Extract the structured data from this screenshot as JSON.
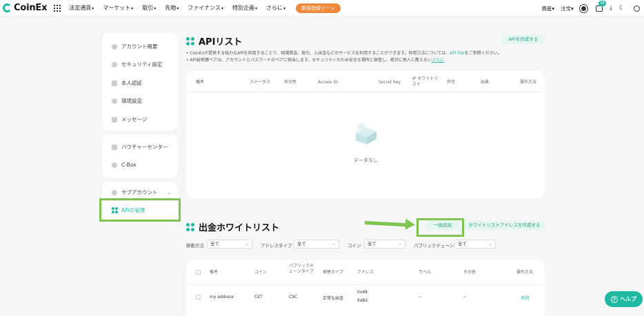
{
  "header": {
    "brand": "CoinEx",
    "nav": [
      "法定通貨",
      "マーケット",
      "取引",
      "先物",
      "ファイナンス",
      "特別企画",
      "さらに"
    ],
    "promo": "新規登録ゾーン",
    "right": [
      "資産",
      "注文"
    ],
    "notification_count": "26"
  },
  "sidebar": {
    "group1": [
      "アカウント概要",
      "セキュリティ設定",
      "本人認証",
      "環境設定",
      "メッセージ"
    ],
    "group2": [
      "バウチャーセンター",
      "C-Box"
    ],
    "group3": [
      "サブアカウント",
      "APIの管理"
    ]
  },
  "api": {
    "title": "APIリスト",
    "create_button": "APIを作成する",
    "note1_pre": "• CoinExが提供する強力なAPIを利用することで、相場照会、取引、入出金などのサービスを利用することができます。利用方法については、",
    "note1_link": "API File",
    "note1_post": "をご参照ください。",
    "note2_pre": "• API秘密鍵ペアは、アカウントとパスワードのペアに相当します。セキュリティのため安全な場所に保管し、絶対に他人に教えないでください。",
    "note2_link": "さらに",
    "columns": [
      "備考",
      "ステータス",
      "有効性",
      "Access ID",
      "Secret Key",
      "IP ホワイトリスト",
      "許可",
      "出典",
      "操作方法"
    ],
    "empty_text": "データなし"
  },
  "whitelist": {
    "title": "出金ホワイトリスト",
    "bulk_button": "一括追加",
    "create_button": "ホワイトリストアドレスを作成する",
    "filters": [
      {
        "label": "移動方法",
        "value": "全て"
      },
      {
        "label": "アドレスタイプ",
        "value": "全て"
      },
      {
        "label": "コイン",
        "value": "全て"
      },
      {
        "label": "パブリックチェーン",
        "value": "全て"
      }
    ],
    "columns": [
      "備考",
      "コイン",
      "パブリックチェーンタイプ",
      "振替タイプ",
      "アドレス",
      "ラベル",
      "その他",
      "操作方法"
    ],
    "rows": [
      {
        "note": "my address",
        "coin": "CET",
        "chain": "CSC",
        "type": "正常な出金",
        "address1": "0x48",
        "address2": "6aB2",
        "label": "--",
        "other": "--",
        "action": "削除"
      }
    ]
  },
  "help": "ヘルプ"
}
